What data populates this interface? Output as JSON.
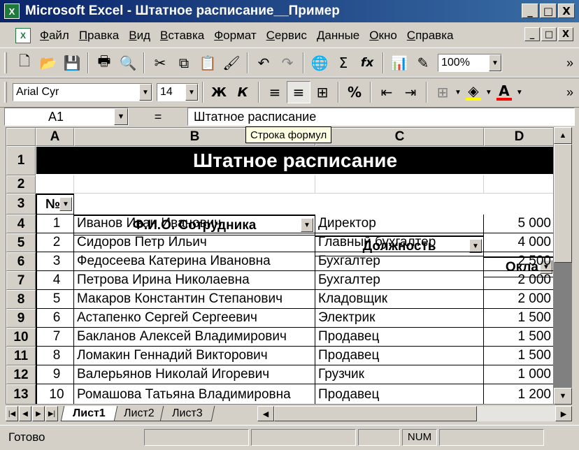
{
  "window": {
    "title": "Microsoft Excel - Штатное расписание__Пример",
    "logo": "X",
    "minimize_icon": "_",
    "restore_icon": "□",
    "close_icon": "X"
  },
  "menu": {
    "doc_icon": "X",
    "items": [
      "Файл",
      "Правка",
      "Вид",
      "Вставка",
      "Формат",
      "Сервис",
      "Данные",
      "Окно",
      "Справка"
    ]
  },
  "toolbar1": {
    "icons": [
      "new-icon",
      "open-icon",
      "save-icon",
      "print-icon",
      "print-preview-icon",
      "cut-icon",
      "copy-icon",
      "paste-icon",
      "format-painter-icon",
      "undo-icon",
      "redo-icon",
      "hyperlink-icon",
      "autosum-icon",
      "function-icon",
      "chart-wizard-icon",
      "drawing-icon"
    ],
    "glyphs": {
      "new": "🗋",
      "open": "📂",
      "save": "💾",
      "print": "🖶",
      "preview": "🔍",
      "cut": "✂",
      "copy": "⧉",
      "paste": "📋",
      "painter": "🖌",
      "undo": "↶",
      "redo": "↷",
      "hyperlink": "🌐",
      "sum": "Σ",
      "fx": "fx",
      "chart": "📊",
      "drawing": "✎"
    },
    "zoom": "100%",
    "more": "»"
  },
  "toolbar2": {
    "font": "Arial Cyr",
    "size": "14",
    "bold": "Ж",
    "italic": "К",
    "percent": "%",
    "more": "»",
    "glyphs": {
      "align_left": "≡",
      "align_center": "≡",
      "merge": "⊞",
      "decrease_indent": "⇤",
      "increase_indent": "⇥",
      "borders": "⊞",
      "fill": "◈",
      "font_color": "A"
    },
    "fill_color": "#ffff00",
    "font_color_bar": "#ff0000"
  },
  "formula": {
    "namebox": "A1",
    "equals": "=",
    "content": "Штатное расписание"
  },
  "tooltip": "Строка формул",
  "grid": {
    "columns": [
      "A",
      "B",
      "C",
      "D"
    ],
    "rows": [
      "1",
      "2",
      "3",
      "4",
      "5",
      "6",
      "7",
      "8",
      "9",
      "10",
      "11",
      "12",
      "13"
    ],
    "title": "Штатное расписание",
    "headers": [
      "№",
      "Ф.И.О. Сотрудника",
      "Должность",
      "Окла"
    ],
    "dropdown_glyph": "▼",
    "data": [
      [
        "1",
        "Иванов Иван Иванович",
        "Директор",
        "5 000"
      ],
      [
        "2",
        "Сидоров Петр Ильич",
        "Главный бухгалтер",
        "4 000"
      ],
      [
        "3",
        "Федосеева Катерина Ивановна",
        "Бухгалтер",
        "2 500"
      ],
      [
        "4",
        "Петрова Ирина Николаевна",
        "Бухгалтер",
        "2 000"
      ],
      [
        "5",
        "Макаров Константин Степанович",
        "Кладовщик",
        "2 000"
      ],
      [
        "6",
        "Астапенко Сергей Сергеевич",
        "Электрик",
        "1 500"
      ],
      [
        "7",
        "Бакланов Алексей Владимирович",
        "Продавец",
        "1 500"
      ],
      [
        "8",
        "Ломакин Геннадий Викторович",
        "Продавец",
        "1 500"
      ],
      [
        "9",
        "Валерьянов Николай Игоревич",
        "Грузчик",
        "1 000"
      ],
      [
        "10",
        "Ромашова Татьяна Владимировна",
        "Продавец",
        "1 200"
      ]
    ]
  },
  "scroll": {
    "up": "▲",
    "down": "▼",
    "left": "◀",
    "right": "▶"
  },
  "sheets": {
    "nav": [
      "|◀",
      "◀",
      "▶",
      "▶|"
    ],
    "tabs": [
      "Лист1",
      "Лист2",
      "Лист3"
    ]
  },
  "status": {
    "text": "Готово",
    "num": "NUM"
  }
}
